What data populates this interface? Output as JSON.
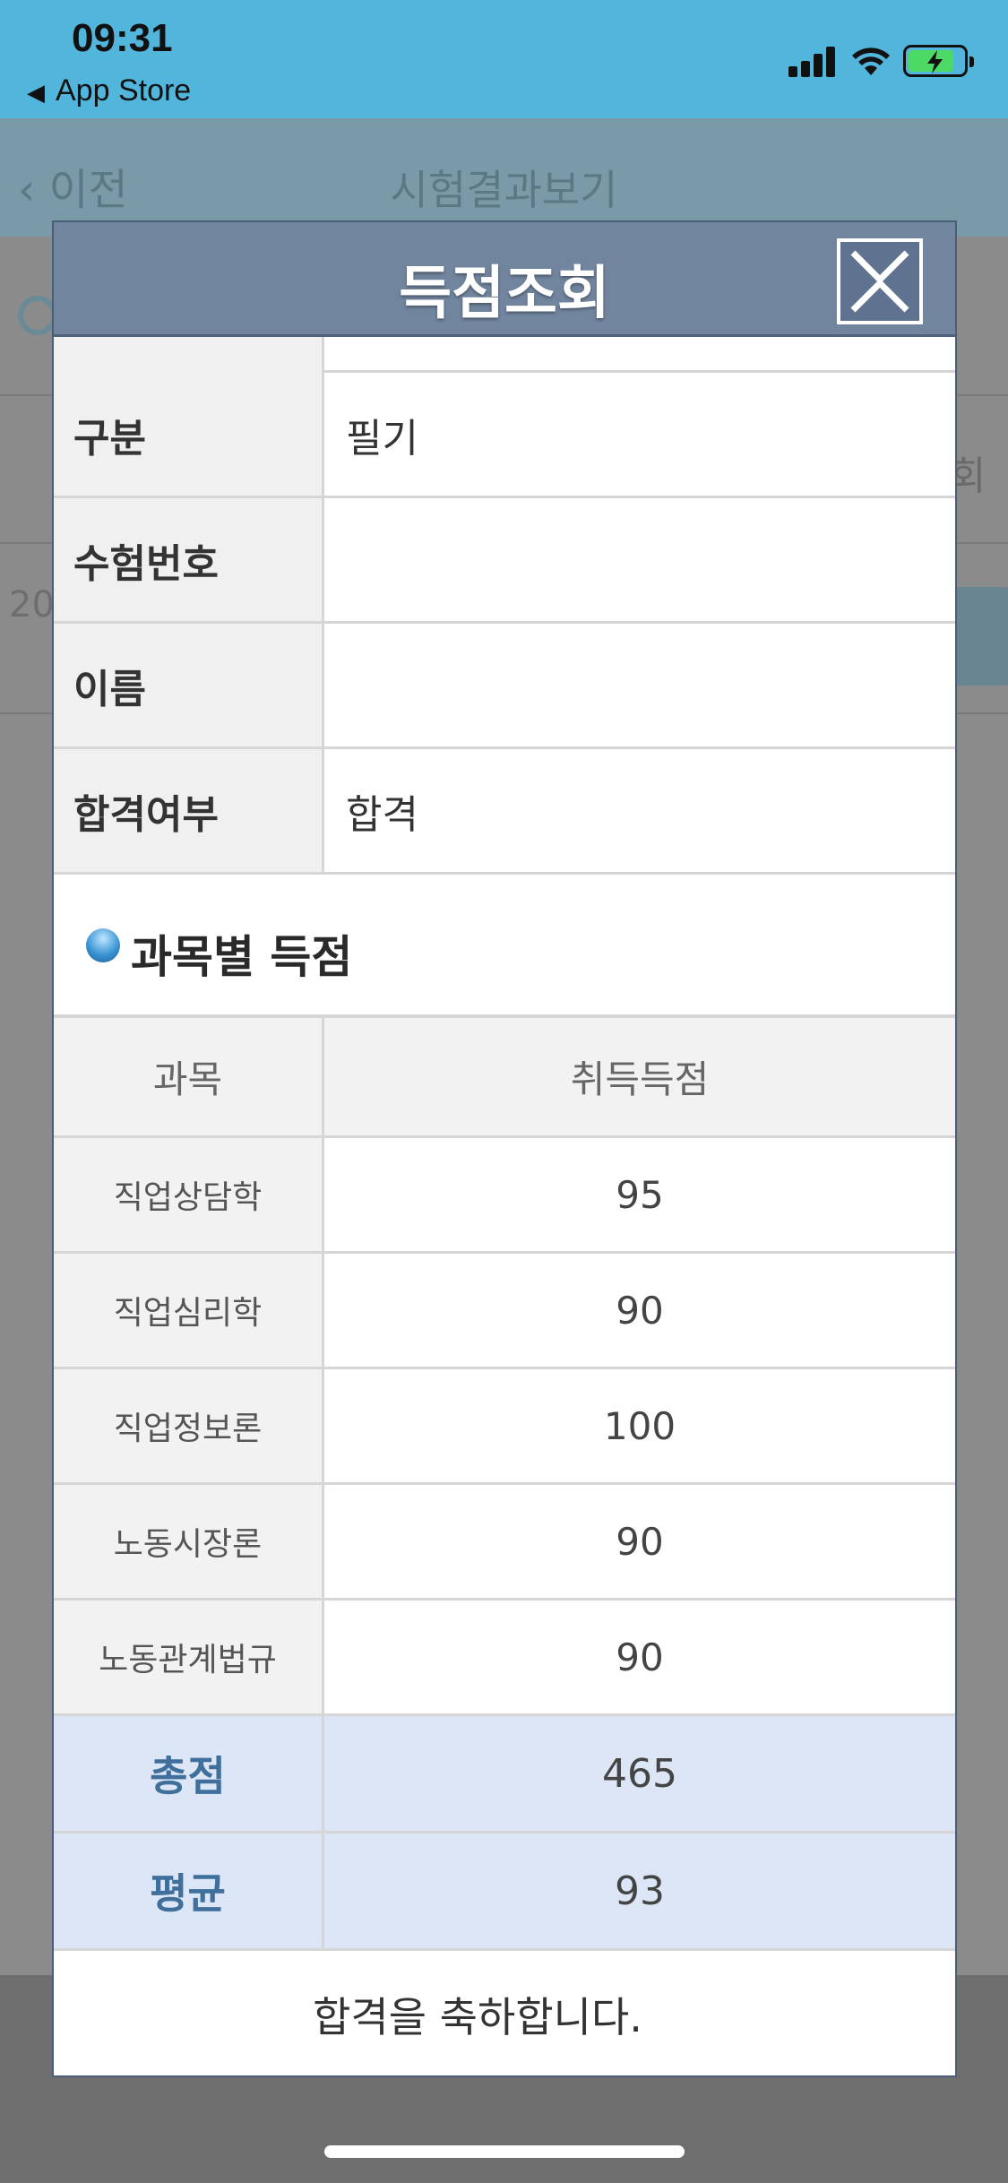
{
  "status_bar": {
    "time": "09:31",
    "back_app": "App Store"
  },
  "page": {
    "back_label": "이전",
    "title": "시험결과보기",
    "under_row_text": "20",
    "under_right_text": "회"
  },
  "modal": {
    "title": "득점조회",
    "info_rows": [
      {
        "label": "구분",
        "value": "필기"
      },
      {
        "label": "수험번호",
        "value": ""
      },
      {
        "label": "이름",
        "value": ""
      },
      {
        "label": "합격여부",
        "value": "합격"
      }
    ],
    "section_title": "과목별 득점",
    "table_headers": {
      "subject": "과목",
      "score": "취득득점"
    },
    "subjects": [
      {
        "name": "직업상담학",
        "score": "95"
      },
      {
        "name": "직업심리학",
        "score": "90"
      },
      {
        "name": "직업정보론",
        "score": "100"
      },
      {
        "name": "노동시장론",
        "score": "90"
      },
      {
        "name": "노동관계법규",
        "score": "90"
      }
    ],
    "total": {
      "label": "총점",
      "value": "465"
    },
    "average": {
      "label": "평균",
      "value": "93"
    },
    "congrats": "합격을 축하합니다."
  },
  "colors": {
    "status_bar": "#52b6dc",
    "modal_header": "#71859f",
    "summary_bg": "#dde6f6",
    "summary_label": "#3f6f9a"
  }
}
